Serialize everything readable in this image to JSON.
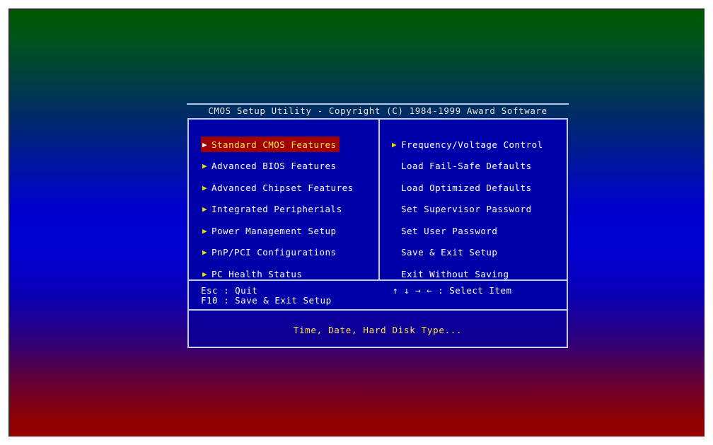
{
  "window": {
    "title": "CMOS Setup Utility - Copyright (C) 1984-1999 Award Software"
  },
  "menu": {
    "left_column": [
      {
        "label": "Standard CMOS Features",
        "arrow": "▶",
        "selected": true
      },
      {
        "label": "Advanced BIOS Features",
        "arrow": "▶",
        "selected": false
      },
      {
        "label": "Advanced Chipset Features",
        "arrow": "▶",
        "selected": false
      },
      {
        "label": "Integrated Peripherials",
        "arrow": "▶",
        "selected": false
      },
      {
        "label": "Power Management Setup",
        "arrow": "▶",
        "selected": false
      },
      {
        "label": "PnP/PCI Configurations",
        "arrow": "▶",
        "selected": false
      },
      {
        "label": "PC Health Status",
        "arrow": "▶",
        "selected": false
      }
    ],
    "right_column": [
      {
        "label": "Frequency/Voltage Control",
        "arrow": "▶",
        "selected": false
      },
      {
        "label": "Load Fail-Safe Defaults",
        "arrow": "",
        "selected": false
      },
      {
        "label": "Load Optimized Defaults",
        "arrow": "",
        "selected": false
      },
      {
        "label": "Set Supervisor Password",
        "arrow": "",
        "selected": false
      },
      {
        "label": "Set User Password",
        "arrow": "",
        "selected": false
      },
      {
        "label": "Save & Exit Setup",
        "arrow": "",
        "selected": false
      },
      {
        "label": "Exit Without Saving",
        "arrow": "",
        "selected": false
      }
    ]
  },
  "help": {
    "esc": "Esc : Quit",
    "f10": "F10 : Save & Exit Setup",
    "navigation": "↑ ↓ → ←      : Select Item"
  },
  "description": {
    "text": "Time, Date, Hard Disk Type..."
  },
  "colors": {
    "panel_background": "#0000a8",
    "panel_border": "#c5d0ee",
    "selected_background": "#a00000",
    "selected_text": "#ffe84a",
    "arrow": "#e8e000",
    "menu_text": "#ffffff",
    "description_text": "#ffe14a",
    "bezel": "#ffffff"
  }
}
